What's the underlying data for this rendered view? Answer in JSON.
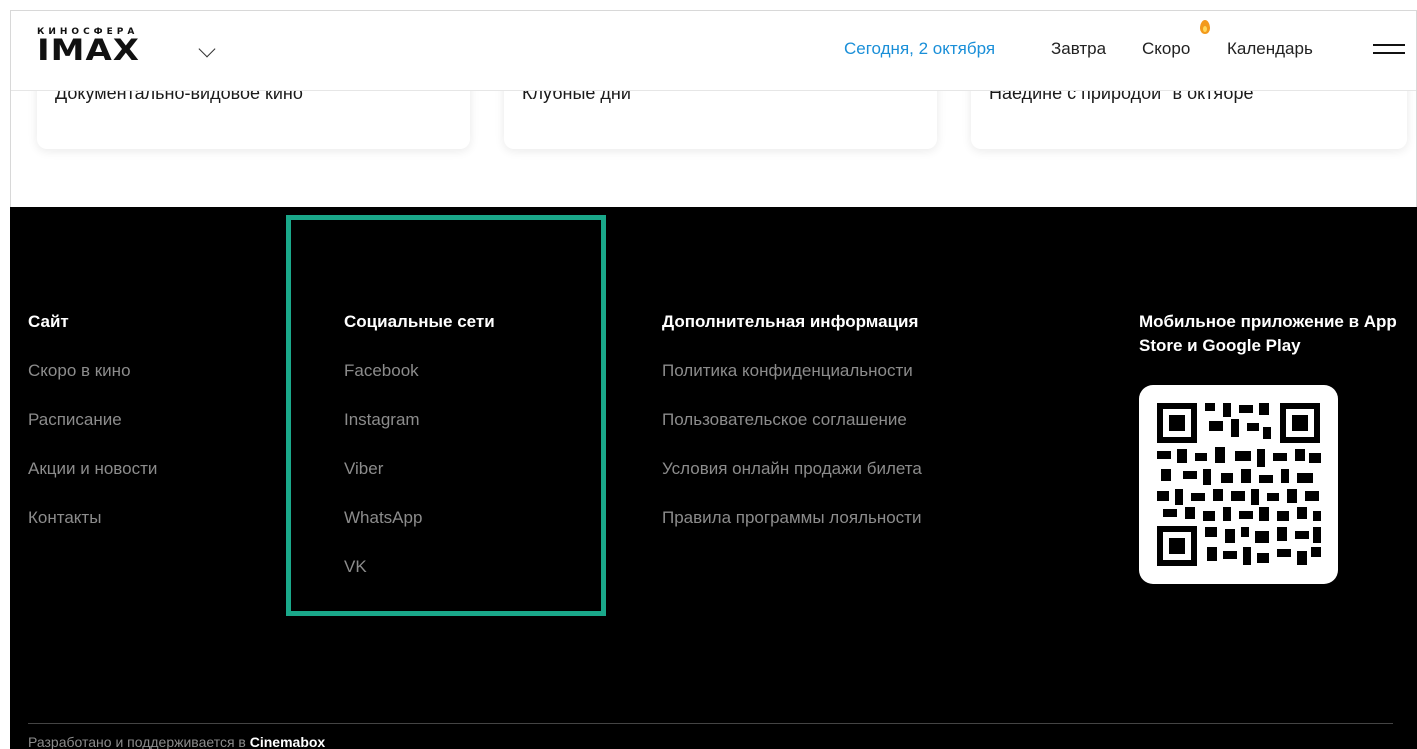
{
  "header": {
    "logo_small": "КИНОСФЕРА",
    "logo_big": "IMAX",
    "nav": {
      "today": "Сегодня, 2 октября",
      "tomorrow": "Завтра",
      "soon": "Скоро",
      "calendar": "Календарь"
    },
    "accent_color": "#1a8fd8"
  },
  "cards": [
    {
      "title": "Документально-видовое кино"
    },
    {
      "title": "Клубные дни"
    },
    {
      "title": "Наедине с природой\" в октябре"
    }
  ],
  "footer": {
    "site": {
      "title": "Сайт",
      "links": [
        "Скоро в кино",
        "Расписание",
        "Акции и новости",
        "Контакты"
      ]
    },
    "social": {
      "title": "Социальные сети",
      "links": [
        "Facebook",
        "Instagram",
        "Viber",
        "WhatsApp",
        "VK"
      ]
    },
    "info": {
      "title": "Дополнительная информация",
      "links": [
        "Политика конфиденциальности",
        "Пользовательское соглашение",
        "Условия онлайн продажи билета",
        "Правила программы лояльности"
      ]
    },
    "app": {
      "title": "Мобильное приложение в App Store и Google Play"
    },
    "credits_prefix": "Разработано и поддерживается в",
    "credits_brand": "Cinemabox",
    "highlight_color": "#1aa88a"
  }
}
